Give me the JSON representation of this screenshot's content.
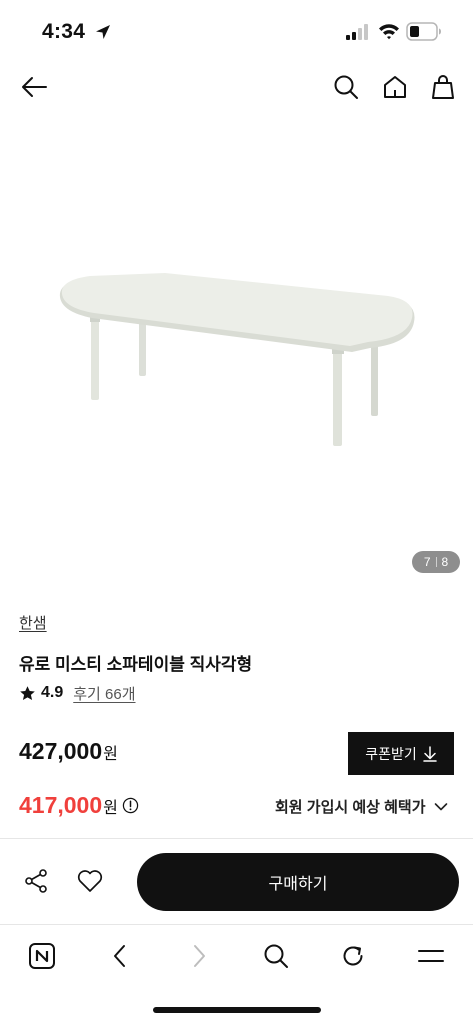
{
  "status_bar": {
    "time": "4:34",
    "icons": [
      "location-arrow-icon",
      "signal-icon",
      "wifi-icon",
      "battery-icon"
    ]
  },
  "nav": {
    "icons": [
      "back-arrow-icon",
      "search-icon",
      "home-icon",
      "shopping-bag-icon"
    ]
  },
  "gallery": {
    "current": "7",
    "total": "8"
  },
  "product": {
    "brand": "한샘",
    "title": "유로 미스티 소파테이블 직사각형",
    "rating": "4.9",
    "review_link": "후기 66개",
    "price_original": "427,000",
    "price_unit": "원",
    "price_sale": "417,000",
    "sale_color": "#f0403c"
  },
  "coupon": {
    "label": "쿠폰받기"
  },
  "benefit": {
    "label": "회원 가입시 예상 혜택가"
  },
  "action_bar": {
    "buy_label": "구매하기"
  },
  "browser_bar": {
    "icons": [
      "naver-logo-icon",
      "back-icon",
      "forward-icon",
      "search-icon",
      "refresh-icon",
      "menu-icon"
    ]
  }
}
